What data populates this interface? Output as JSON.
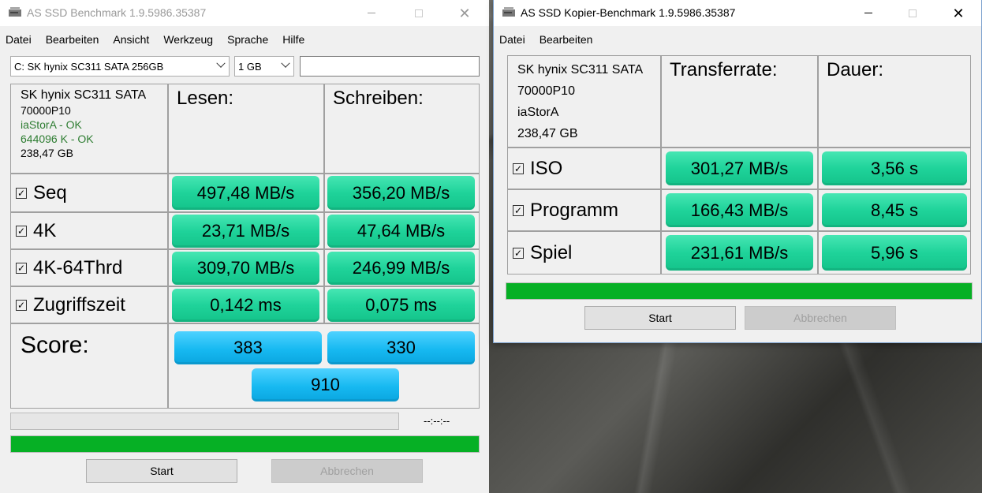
{
  "left": {
    "title": "AS SSD Benchmark 1.9.5986.35387",
    "menu": [
      "Datei",
      "Bearbeiten",
      "Ansicht",
      "Werkzeug",
      "Sprache",
      "Hilfe"
    ],
    "drive_select": "C: SK hynix SC311 SATA 256GB",
    "size_select": "1 GB",
    "search_value": "",
    "info": {
      "model": "SK hynix SC311 SATA",
      "firmware": "70000P10",
      "driver": "iaStorA - OK",
      "alignment": "644096 K - OK",
      "capacity": "238,47 GB"
    },
    "headers": {
      "read": "Lesen:",
      "write": "Schreiben:"
    },
    "rows": [
      {
        "label": "Seq",
        "read": "497,48 MB/s",
        "write": "356,20 MB/s"
      },
      {
        "label": "4K",
        "read": "23,71 MB/s",
        "write": "47,64 MB/s"
      },
      {
        "label": "4K-64Thrd",
        "read": "309,70 MB/s",
        "write": "246,99 MB/s"
      },
      {
        "label": "Zugriffszeit",
        "read": "0,142 ms",
        "write": "0,075 ms"
      }
    ],
    "score": {
      "label": "Score:",
      "read": "383",
      "write": "330",
      "total": "910"
    },
    "elapsed": "--:--:--",
    "progress": 0,
    "progress_done": 1,
    "buttons": {
      "start": "Start",
      "abort": "Abbrechen"
    }
  },
  "right": {
    "title": "AS SSD Kopier-Benchmark 1.9.5986.35387",
    "menu": [
      "Datei",
      "Bearbeiten"
    ],
    "info": {
      "model": "SK hynix SC311 SATA",
      "firmware": "70000P10",
      "driver": "iaStorA",
      "capacity": "238,47 GB"
    },
    "headers": {
      "rate": "Transferrate:",
      "duration": "Dauer:"
    },
    "rows": [
      {
        "label": "ISO",
        "rate": "301,27 MB/s",
        "duration": "3,56 s"
      },
      {
        "label": "Programm",
        "rate": "166,43 MB/s",
        "duration": "8,45 s"
      },
      {
        "label": "Spiel",
        "rate": "231,61 MB/s",
        "duration": "5,96 s"
      }
    ],
    "progress": 1,
    "buttons": {
      "start": "Start",
      "abort": "Abbrechen"
    }
  },
  "colors": {
    "green_pill": "#1fd39a",
    "blue_pill": "#17b9f1",
    "progress_green": "#06b025"
  }
}
